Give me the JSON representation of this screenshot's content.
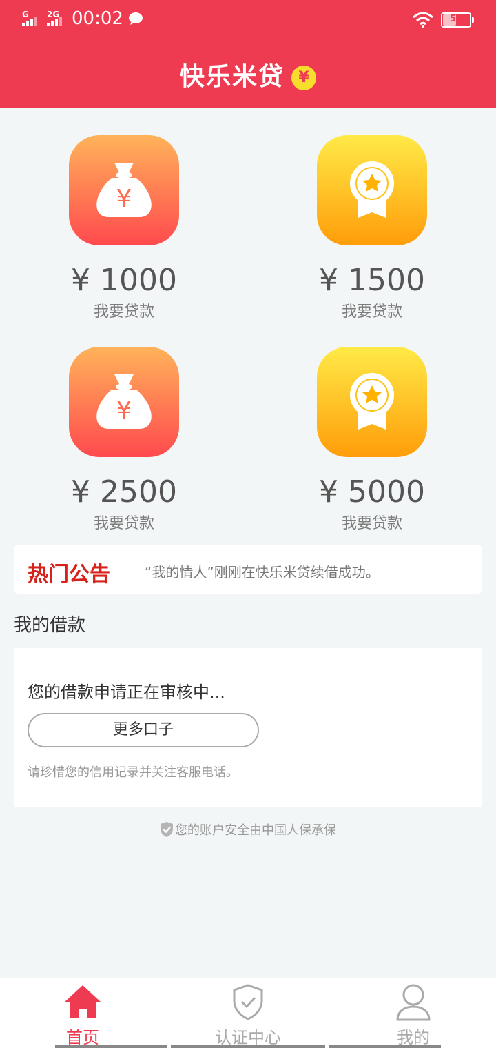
{
  "status_bar": {
    "signal1": "G",
    "signal2": "2G",
    "time": "00:02",
    "battery": "50"
  },
  "header": {
    "title": "快乐米贷",
    "badge": "¥"
  },
  "loans": [
    {
      "amount": "¥ 1000",
      "label": "我要贷款",
      "icon": "money-bag-icon"
    },
    {
      "amount": "¥ 1500",
      "label": "我要贷款",
      "icon": "medal-icon"
    },
    {
      "amount": "¥ 2500",
      "label": "我要贷款",
      "icon": "money-bag-icon"
    },
    {
      "amount": "¥ 5000",
      "label": "我要贷款",
      "icon": "medal-icon"
    }
  ],
  "notice": {
    "label": "热门公告",
    "text": "“我的情人”刚刚在快乐米贷续借成功。"
  },
  "my_loan": {
    "title": "我的借款",
    "status": "您的借款申请正在审核中...",
    "more_button": "更多口子",
    "hint": "请珍惜您的信用记录并关注客服电话。"
  },
  "security_note": "您的账户安全由中国人保承保",
  "tabs": [
    {
      "label": "首页",
      "icon": "home-icon",
      "active": true
    },
    {
      "label": "认证中心",
      "icon": "shield-check-icon",
      "active": false
    },
    {
      "label": "我的",
      "icon": "user-icon",
      "active": false
    }
  ],
  "colors": {
    "brand": "#ef3b52",
    "notice_label": "#d7221b",
    "orange_tile_top": "#ffb35a",
    "orange_tile_bottom": "#ff4a4e",
    "gold_tile_top": "#ffea47",
    "gold_tile_bottom": "#ff9d0a"
  }
}
